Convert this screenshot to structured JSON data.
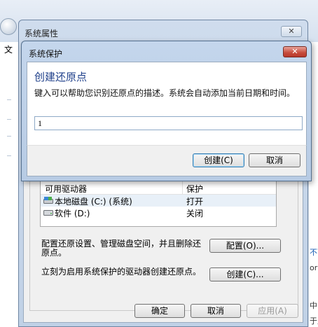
{
  "background": {
    "menu_label": "文",
    "right_fragments": [
      "不可",
      "or",
      "中",
      "于此"
    ]
  },
  "system_properties": {
    "title": "系统属性",
    "close_symbol": "✕",
    "drives_table": {
      "headers": [
        "可用驱动器",
        "保护"
      ],
      "rows": [
        {
          "name": "本地磁盘 (C:) (系统)",
          "protection": "打开",
          "icon": "system-drive-icon"
        },
        {
          "name": "软件 (D:)",
          "protection": "关闭",
          "icon": "drive-icon"
        }
      ]
    },
    "configure_text": "配置还原设置、管理磁盘空间，并且删除还原点。",
    "configure_text_line1": "配置还原设置、管理磁盘空间，并且删除还",
    "configure_text_line2": "原点。",
    "configure_button": "配置(O)...",
    "create_text": "立刻为启用系统保护的驱动器创建还原点。",
    "create_button": "创建(C)...",
    "ok_button": "确定",
    "cancel_button": "取消",
    "apply_button": "应用(A)"
  },
  "system_protection": {
    "title": "系统保护",
    "close_symbol": "✕",
    "heading": "创建还原点",
    "description": "键入可以帮助您识别还原点的描述。系统会自动添加当前日期和时间。",
    "input_value": "1",
    "create_button": "创建(C)",
    "cancel_button": "取消"
  },
  "colors": {
    "heading": "#1e3f8a",
    "close_red": "#c64b3b",
    "link_blue": "#1a5fb4"
  }
}
